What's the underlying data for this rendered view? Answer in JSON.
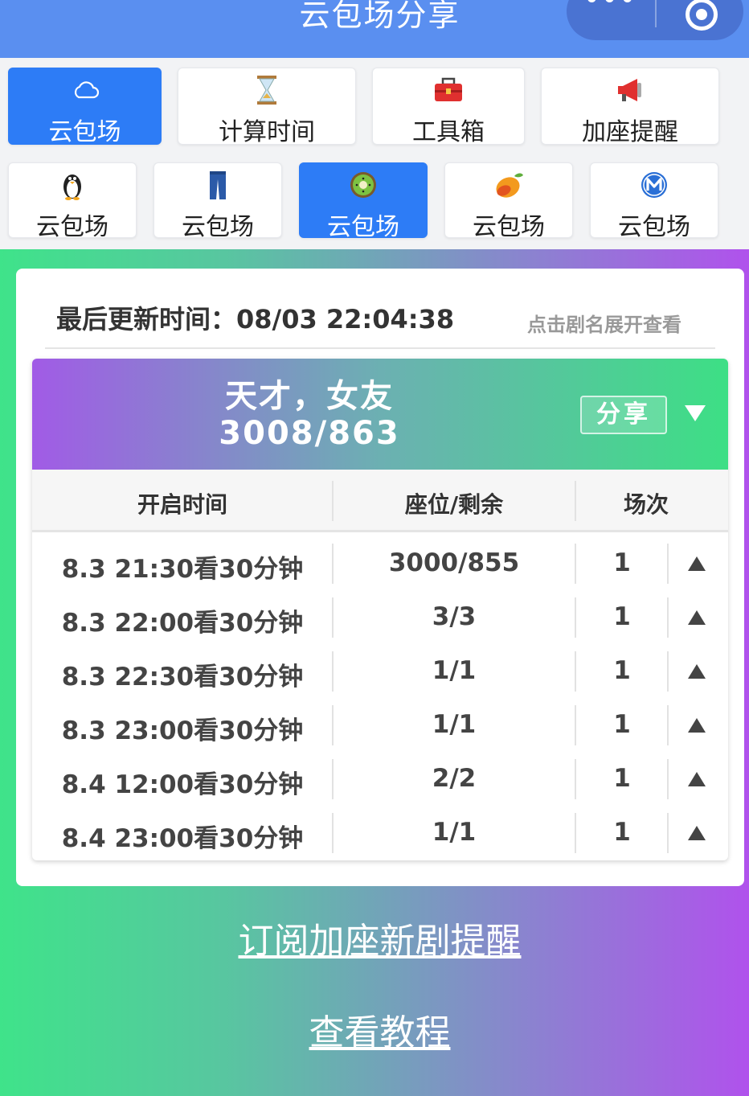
{
  "app": {
    "title": "云包场分享",
    "menu_dots": "•••"
  },
  "top_nav": [
    {
      "label": "云包场",
      "icon": "cloud-icon",
      "active": true
    },
    {
      "label": "计算时间",
      "icon": "hourglass-icon",
      "active": false
    },
    {
      "label": "工具箱",
      "icon": "toolbox-icon",
      "active": false
    },
    {
      "label": "加座提醒",
      "icon": "megaphone-icon",
      "active": false
    }
  ],
  "sub_nav": [
    {
      "label": "云包场",
      "icon": "penguin-icon",
      "active": false
    },
    {
      "label": "云包场",
      "icon": "jeans-icon",
      "active": false
    },
    {
      "label": "云包场",
      "icon": "kiwi-icon",
      "active": true
    },
    {
      "label": "云包场",
      "icon": "mango-icon",
      "active": false
    },
    {
      "label": "云包场",
      "icon": "metro-m-icon",
      "active": false
    }
  ],
  "card": {
    "updated": "最后更新时间：08/03 22:04:38",
    "hint": "点击剧名展开查看"
  },
  "show": {
    "title": "天才，女友",
    "count": "3008/863",
    "share_label": "分享"
  },
  "table": {
    "headers": [
      "开启时间",
      "座位/剩余",
      "场次"
    ],
    "rows": [
      {
        "time": "8.3 21:30看30分钟",
        "seats": "3000/855",
        "sessions": "1"
      },
      {
        "time": "8.3 22:00看30分钟",
        "seats": "3/3",
        "sessions": "1"
      },
      {
        "time": "8.3 22:30看30分钟",
        "seats": "1/1",
        "sessions": "1"
      },
      {
        "time": "8.3 23:00看30分钟",
        "seats": "1/1",
        "sessions": "1"
      },
      {
        "time": "8.4 12:00看30分钟",
        "seats": "2/2",
        "sessions": "1"
      },
      {
        "time": "8.4 23:00看30分钟",
        "seats": "1/1",
        "sessions": "1"
      }
    ]
  },
  "links": {
    "subscribe": "订阅加座新剧提醒",
    "tutorial": "查看教程"
  },
  "colors": {
    "header_blue": "#5a8ff0",
    "active_tab": "#2d7cf6",
    "gradient_green": "#3fe38a",
    "gradient_purple": "#b052ec"
  }
}
